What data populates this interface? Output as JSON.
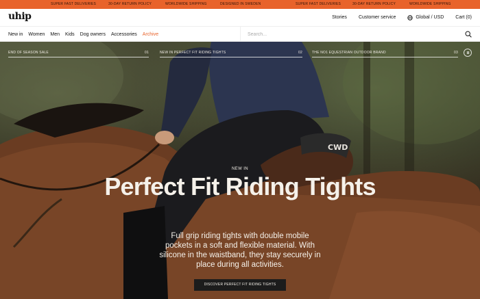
{
  "ticker": {
    "items": [
      "SUPER FAST DELIVERIES",
      "30-DAY RETURN POLICY",
      "WORLDWIDE SHIPPING",
      "DESIGNED IN SWEDEN",
      "SUPER FAST DELIVERIES",
      "30-DAY RETURN POLICY",
      "WORLDWIDE SHIPPING"
    ],
    "background": "#e8632b"
  },
  "header": {
    "logo": "uhip",
    "links": {
      "stories": "Stories",
      "customer_service": "Customer service",
      "region": "Global / USD",
      "cart": "Cart (0)"
    },
    "icons": {
      "region": "globe-icon"
    }
  },
  "nav": {
    "items": [
      "New in",
      "Women",
      "Men",
      "Kids",
      "Dog owners",
      "Accessories",
      "Archive"
    ],
    "highlight_color": "#e8632b",
    "search_placeholder": "Search...",
    "search_icon": "search-icon"
  },
  "hero": {
    "tabs": [
      {
        "label": "END OF SEASON SALE",
        "number": "01"
      },
      {
        "label": "NEW IN PERFECT FIT RIDING TIGHTS",
        "number": "02"
      },
      {
        "label": "THE NO1 EQUESTRIAN OUTDOOR BRAND",
        "number": "03"
      }
    ],
    "pause_icon": "pause-icon",
    "saddle_text": "CWD",
    "eyebrow": "NEW IN",
    "headline": "Perfect Fit Riding Tights",
    "description": "Full grip riding tights with double mobile pockets in a soft and flexible material. With silicone in the waistband, they stay securely in place during all activities.",
    "cta": "DISCOVER PERFECT FIT RIDING TIGHTS"
  }
}
